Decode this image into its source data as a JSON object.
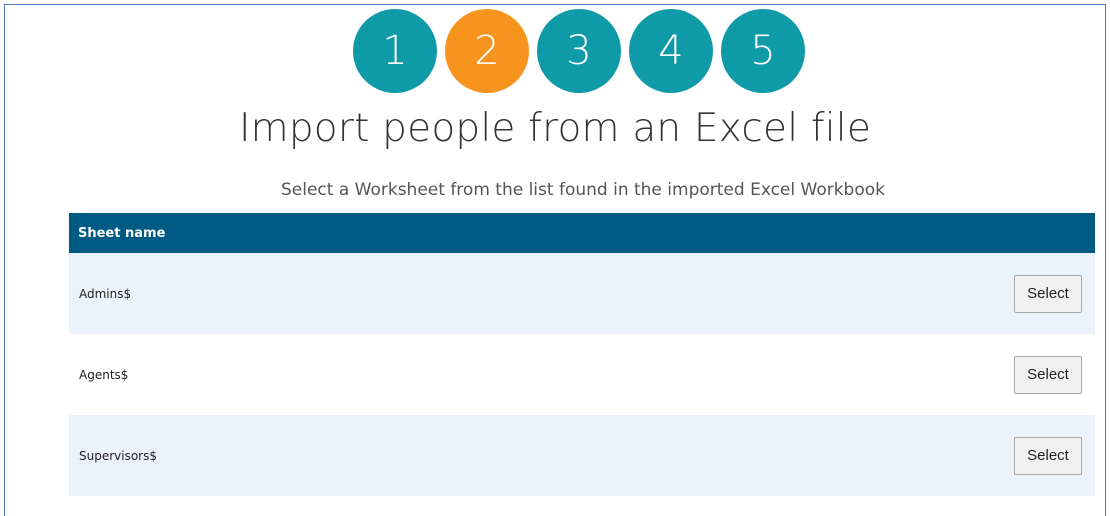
{
  "steps": [
    {
      "label": "1",
      "state": "inactive"
    },
    {
      "label": "2",
      "state": "active"
    },
    {
      "label": "3",
      "state": "inactive"
    },
    {
      "label": "4",
      "state": "inactive"
    },
    {
      "label": "5",
      "state": "inactive"
    }
  ],
  "colors": {
    "step_inactive": "#0f9aa8",
    "step_active": "#f7941d",
    "table_header": "#005b84",
    "row_alt": "#eaf2fb"
  },
  "page": {
    "title": "Import people from an Excel file",
    "subtitle": "Select a Worksheet from the list found in the imported Excel Workbook"
  },
  "table": {
    "header": "Sheet name",
    "rows": [
      {
        "name": "Admins$",
        "button": "Select"
      },
      {
        "name": "Agents$",
        "button": "Select"
      },
      {
        "name": "Supervisors$",
        "button": "Select"
      }
    ]
  }
}
